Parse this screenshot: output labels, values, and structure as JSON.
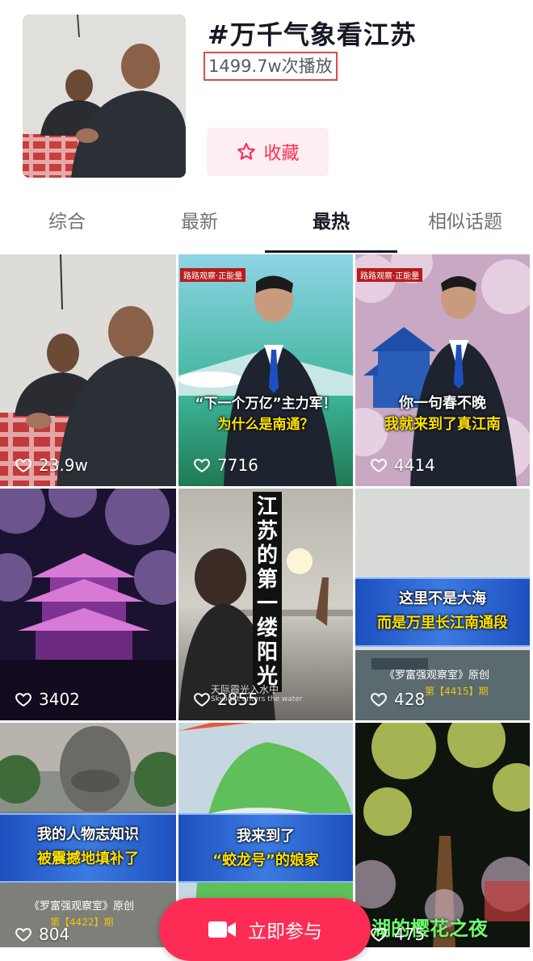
{
  "topic": {
    "title": "#万千气象看江苏",
    "play_count": "1499.7w次播放",
    "favorite_label": "收藏"
  },
  "tabs": [
    {
      "label": "综合",
      "active": false
    },
    {
      "label": "最新",
      "active": false
    },
    {
      "label": "最热",
      "active": true
    },
    {
      "label": "相似话题",
      "active": false
    }
  ],
  "videos": [
    {
      "likes": "23.9w"
    },
    {
      "likes": "7716",
      "badge": "路路观察·正能量",
      "caption_line1": "“下一个万亿”主力军！",
      "caption_line2": "为什么是南通？"
    },
    {
      "likes": "4414",
      "badge": "路路观察·正能量",
      "caption_line1": "你一句春不晚",
      "caption_line2": "我就来到了真江南"
    },
    {
      "likes": "3402"
    },
    {
      "likes": "2855",
      "vertical_text": "江苏的第一缕阳光",
      "subtitle": "天际霞光入水中",
      "subtitle_en": "Skylight enters the water"
    },
    {
      "likes": "428",
      "caption_line1": "这里不是大海",
      "caption_line2": "而是万里长江南通段",
      "source_line": "《罗富强观察室》原创",
      "episode": "第【4415】期"
    },
    {
      "likes": "804",
      "caption_line1": "我的人物志知识",
      "caption_line2": "被震撼地填补了",
      "source_line": "《罗富强观察室》原创",
      "episode": "第【4422】期"
    },
    {
      "likes": "",
      "caption_line1": "我来到了",
      "caption_line2": "“蛟龙号”的娘家"
    },
    {
      "likes": "475",
      "night_title": "湖的樱花之夜"
    }
  ],
  "join_button": {
    "label": "立即参与"
  },
  "colors": {
    "accent": "#fe2c55",
    "highlight_box": "#e04848"
  }
}
